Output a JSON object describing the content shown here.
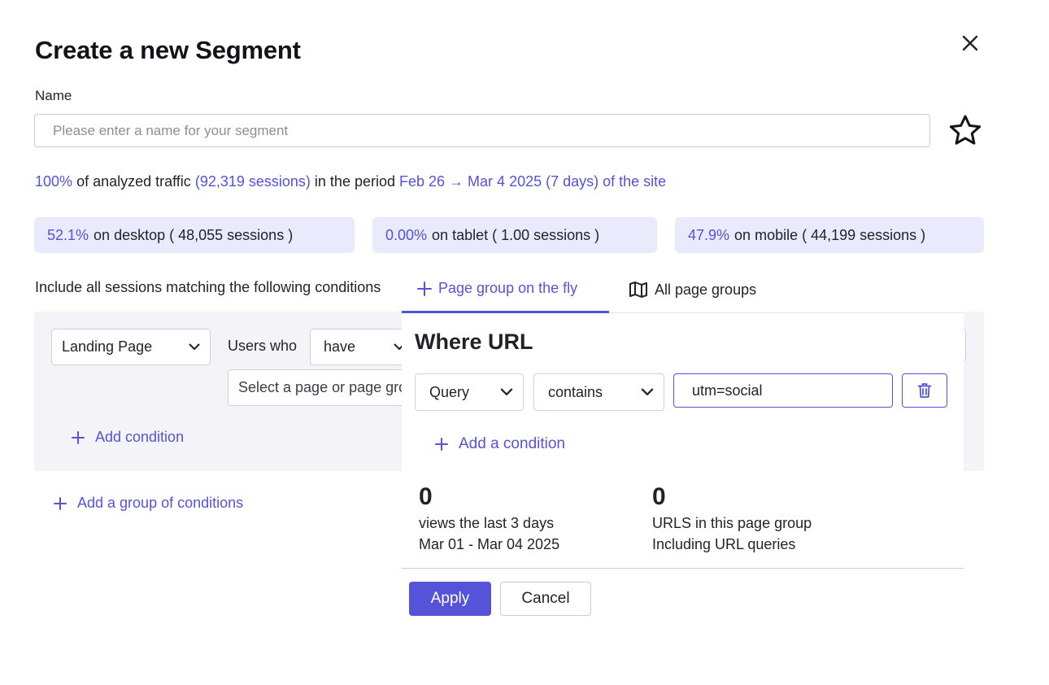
{
  "modal": {
    "title": "Create a new Segment",
    "name_label": "Name",
    "name_placeholder": "Please enter a name for your segment",
    "name_value": ""
  },
  "traffic": {
    "percent": "100%",
    "text_1": "of analyzed traffic",
    "sessions": "(92,319 sessions)",
    "text_2": "in the period",
    "period": "Feb 26 → Mar 4 2025 (7 days) of the site"
  },
  "devices": [
    {
      "pct": "52.1%",
      "label": "on desktop ( 48,055 sessions )"
    },
    {
      "pct": "0.00%",
      "label": "on tablet ( 1.00 sessions )"
    },
    {
      "pct": "47.9%",
      "label": "on mobile ( 44,199 sessions )"
    }
  ],
  "conditions": {
    "intro": "Include all sessions matching the following conditions",
    "type_select": "Landing Page",
    "users_who": "Users who",
    "have_select": "have",
    "page_select_placeholder": "Select a page or page group",
    "add_condition": "Add condition",
    "add_group": "Add a group of conditions"
  },
  "popover": {
    "tab_fly": "Page group on the fly",
    "tab_all": "All page groups",
    "where_title": "Where URL",
    "field_select": "Query",
    "operator_select": "contains",
    "url_value": "utm=social",
    "add_condition": "Add a condition",
    "views_count": "0",
    "views_label": "views the last 3 days",
    "views_range": "Mar 01 - Mar 04 2025",
    "urls_count": "0",
    "urls_label": "URLS in this page group",
    "urls_note": "Including URL queries"
  },
  "actions": {
    "apply": "Apply",
    "cancel": "Cancel"
  },
  "colors": {
    "accent": "#5553d9",
    "stat_bg": "#e9eafb",
    "condition_bg": "#f4f4f8"
  },
  "icons": [
    "close-icon",
    "star-icon",
    "plus-icon",
    "map-icon",
    "chevron-down-icon",
    "trash-icon"
  ]
}
